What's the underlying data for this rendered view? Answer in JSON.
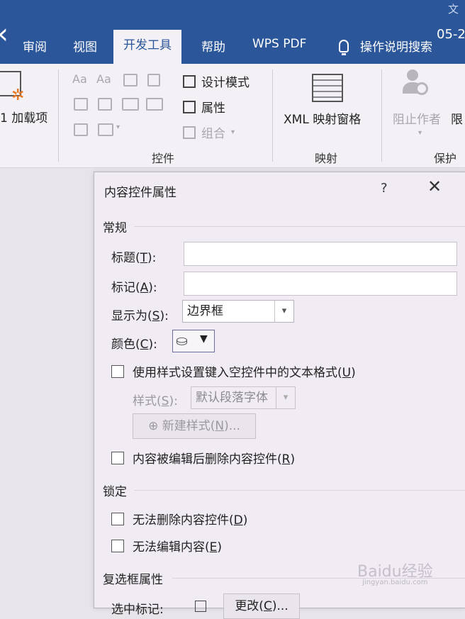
{
  "window": {
    "title_fragment": "文",
    "date_fragment": "05-2"
  },
  "tabs": [
    {
      "label": "审阅"
    },
    {
      "label": "视图"
    },
    {
      "label": "开发工具",
      "active": true
    },
    {
      "label": "帮助"
    },
    {
      "label": "WPS PDF"
    }
  ],
  "tell_me": {
    "label": "操作说明搜索"
  },
  "ribbon": {
    "addins": {
      "label": "1 加载项"
    },
    "controls": {
      "group_label": "控件",
      "design_mode": "设计模式",
      "properties": "属性",
      "group": "组合",
      "icons": [
        "Aa",
        "Aa"
      ]
    },
    "mapping": {
      "group_label": "映射",
      "xml_pane": "XML 映射窗格"
    },
    "protect": {
      "group_label": "保护",
      "block_authors": "阻止作者",
      "restrict": "限"
    }
  },
  "dialog": {
    "title": "内容控件属性",
    "help": "?",
    "close": "✕",
    "general": {
      "section": "常规",
      "title_label": "标题(",
      "title_key": "T",
      "title_suffix": "):",
      "title_value": "",
      "tag_label": "标记(",
      "tag_key": "A",
      "tag_suffix": "):",
      "tag_value": "",
      "show_as_label": "显示为(",
      "show_as_key": "S",
      "show_as_suffix": "):",
      "show_as_value": "边界框",
      "color_label": "颜色(",
      "color_key": "C",
      "color_suffix": "):",
      "use_style_label": "使用样式设置键入空控件中的文本格式(",
      "use_style_key": "U",
      "use_style_suffix": ")",
      "style_label": "样式(",
      "style_key": "S",
      "style_suffix": "):",
      "style_value": "默认段落字体",
      "new_style_prefix": "新建样式(",
      "new_style_key": "N",
      "new_style_suffix": ")...",
      "remove_label": "内容被编辑后删除内容控件(",
      "remove_key": "R",
      "remove_suffix": ")"
    },
    "locking": {
      "section": "锁定",
      "no_delete_label": "无法删除内容控件(",
      "no_delete_key": "D",
      "no_delete_suffix": ")",
      "no_edit_label": "无法编辑内容(",
      "no_edit_key": "E",
      "no_edit_suffix": ")"
    },
    "checkbox_props": {
      "section": "复选框属性",
      "checked_label": "选中标记:",
      "change_prefix": "更改(",
      "change_key": "C",
      "change_suffix": ")..."
    }
  },
  "watermark": {
    "text": "Baidu经验",
    "sub": "jingyan.baidu.com"
  }
}
